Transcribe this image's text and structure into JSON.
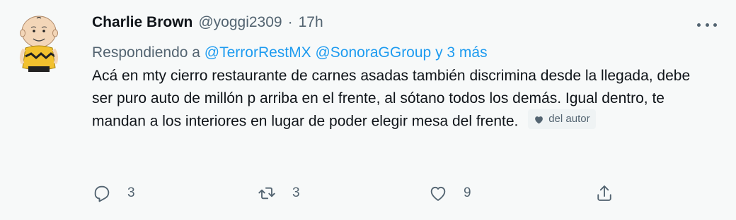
{
  "tweet": {
    "author_name": "Charlie Brown",
    "author_handle": "@yoggi2309",
    "separator": "·",
    "time": "17h",
    "replying_prefix": "Respondiendo a ",
    "mention_1": "@TerrorRestMX",
    "mention_2": "@SonoraGGroup",
    "mention_more": "y 3 más",
    "text": "Acá en mty cierro restaurante de carnes asadas también discrimina desde la llegada, debe ser puro auto de millón p arriba en el frente, al sótano todos los demás. Igual dentro, te mandan a los interiores en lugar de poder elegir mesa del frente.",
    "author_badge": "del autor",
    "badge_icon": "heart-icon"
  },
  "actions": {
    "reply_count": "3",
    "retweet_count": "3",
    "like_count": "9",
    "reply_icon": "reply-icon",
    "retweet_icon": "retweet-icon",
    "like_icon": "heart-icon",
    "share_icon": "share-icon"
  },
  "colors": {
    "background": "#f7f9f9",
    "primary_text": "#0f1419",
    "secondary_text": "#536471",
    "link": "#1d9bf0"
  }
}
